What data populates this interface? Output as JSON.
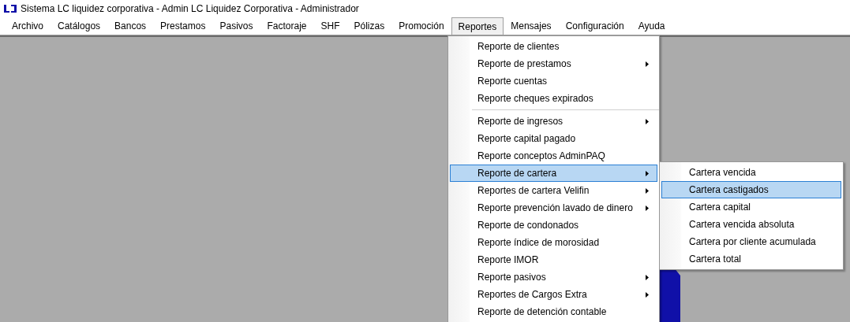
{
  "window": {
    "title": "Sistema LC liquidez corporativa - Admin LC Liquidez Corporativa - Administrador"
  },
  "menu_bar": [
    {
      "label": "Archivo",
      "selected": false
    },
    {
      "label": "Catálogos",
      "selected": false
    },
    {
      "label": "Bancos",
      "selected": false
    },
    {
      "label": "Prestamos",
      "selected": false
    },
    {
      "label": "Pasivos",
      "selected": false
    },
    {
      "label": "Factoraje",
      "selected": false
    },
    {
      "label": "SHF",
      "selected": false
    },
    {
      "label": "Pólizas",
      "selected": false
    },
    {
      "label": "Promoción",
      "selected": false
    },
    {
      "label": "Reportes",
      "selected": true
    },
    {
      "label": "Mensajes",
      "selected": false
    },
    {
      "label": "Configuración",
      "selected": false
    },
    {
      "label": "Ayuda",
      "selected": false
    }
  ],
  "dropdown": {
    "groups": [
      [
        {
          "label": "Reporte de clientes",
          "submenu": false,
          "selected": false
        },
        {
          "label": "Reporte de prestamos",
          "submenu": true,
          "selected": false
        },
        {
          "label": "Reporte cuentas",
          "submenu": false,
          "selected": false
        },
        {
          "label": "Reporte cheques expirados",
          "submenu": false,
          "selected": false
        }
      ],
      [
        {
          "label": "Reporte de ingresos",
          "submenu": true,
          "selected": false
        },
        {
          "label": "Reporte capital pagado",
          "submenu": false,
          "selected": false
        },
        {
          "label": "Reporte conceptos AdminPAQ",
          "submenu": false,
          "selected": false
        },
        {
          "label": "Reporte de cartera",
          "submenu": true,
          "selected": true
        },
        {
          "label": "Reportes de cartera Velifin",
          "submenu": true,
          "selected": false
        },
        {
          "label": "Reporte prevención lavado de dinero",
          "submenu": true,
          "selected": false
        },
        {
          "label": "Reporte de condonados",
          "submenu": false,
          "selected": false
        },
        {
          "label": "Reporte índice de morosidad",
          "submenu": false,
          "selected": false
        },
        {
          "label": "Reporte IMOR",
          "submenu": false,
          "selected": false
        },
        {
          "label": "Reporte pasivos",
          "submenu": true,
          "selected": false
        },
        {
          "label": "Reportes de Cargos Extra",
          "submenu": true,
          "selected": false
        },
        {
          "label": "Reporte de detención contable",
          "submenu": false,
          "selected": false
        }
      ]
    ]
  },
  "submenu": {
    "items": [
      {
        "label": "Cartera vencida",
        "selected": false
      },
      {
        "label": "Cartera castigados",
        "selected": true
      },
      {
        "label": "Cartera capital",
        "selected": false
      },
      {
        "label": "Cartera vencida absoluta",
        "selected": false
      },
      {
        "label": "Cartera por cliente acumulada",
        "selected": false
      },
      {
        "label": "Cartera total",
        "selected": false
      }
    ]
  }
}
